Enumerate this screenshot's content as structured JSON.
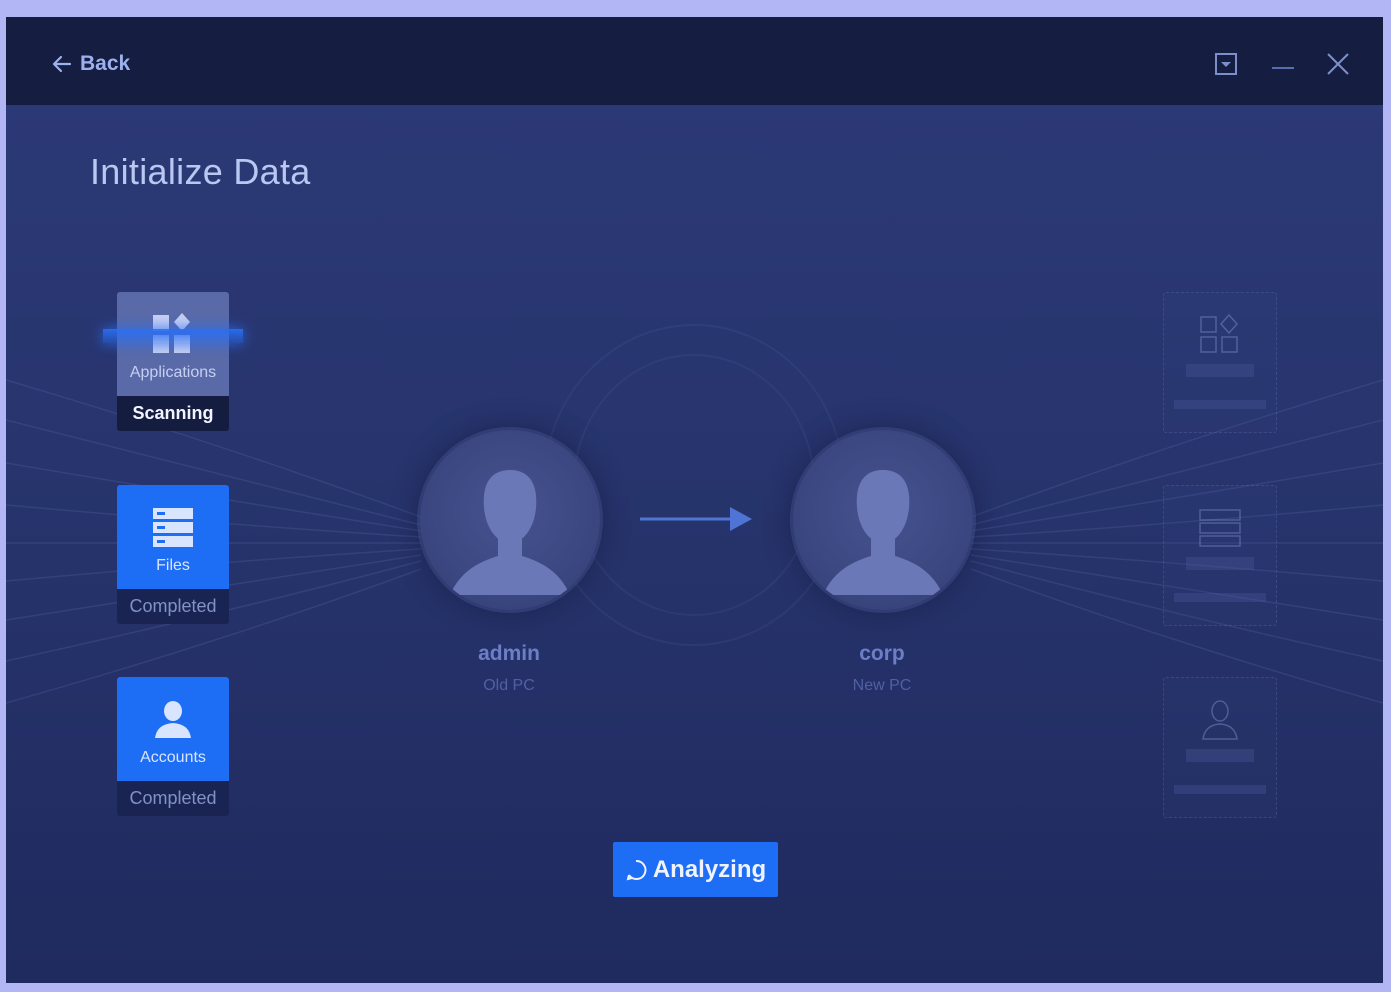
{
  "header": {
    "back_label": "Back"
  },
  "page": {
    "title": "Initialize Data"
  },
  "items": [
    {
      "label": "Applications",
      "status": "Scanning",
      "icon": "applications-icon"
    },
    {
      "label": "Files",
      "status": "Completed",
      "icon": "files-icon"
    },
    {
      "label": "Accounts",
      "status": "Completed",
      "icon": "accounts-icon"
    }
  ],
  "source": {
    "name": "admin",
    "role": "Old PC"
  },
  "target": {
    "name": "corp",
    "role": "New PC"
  },
  "action": {
    "label": "Analyzing",
    "icon": "spinner-icon"
  },
  "colors": {
    "accent": "#1d6ef5",
    "titlebar": "#151d40",
    "background": "#2c3a78"
  }
}
